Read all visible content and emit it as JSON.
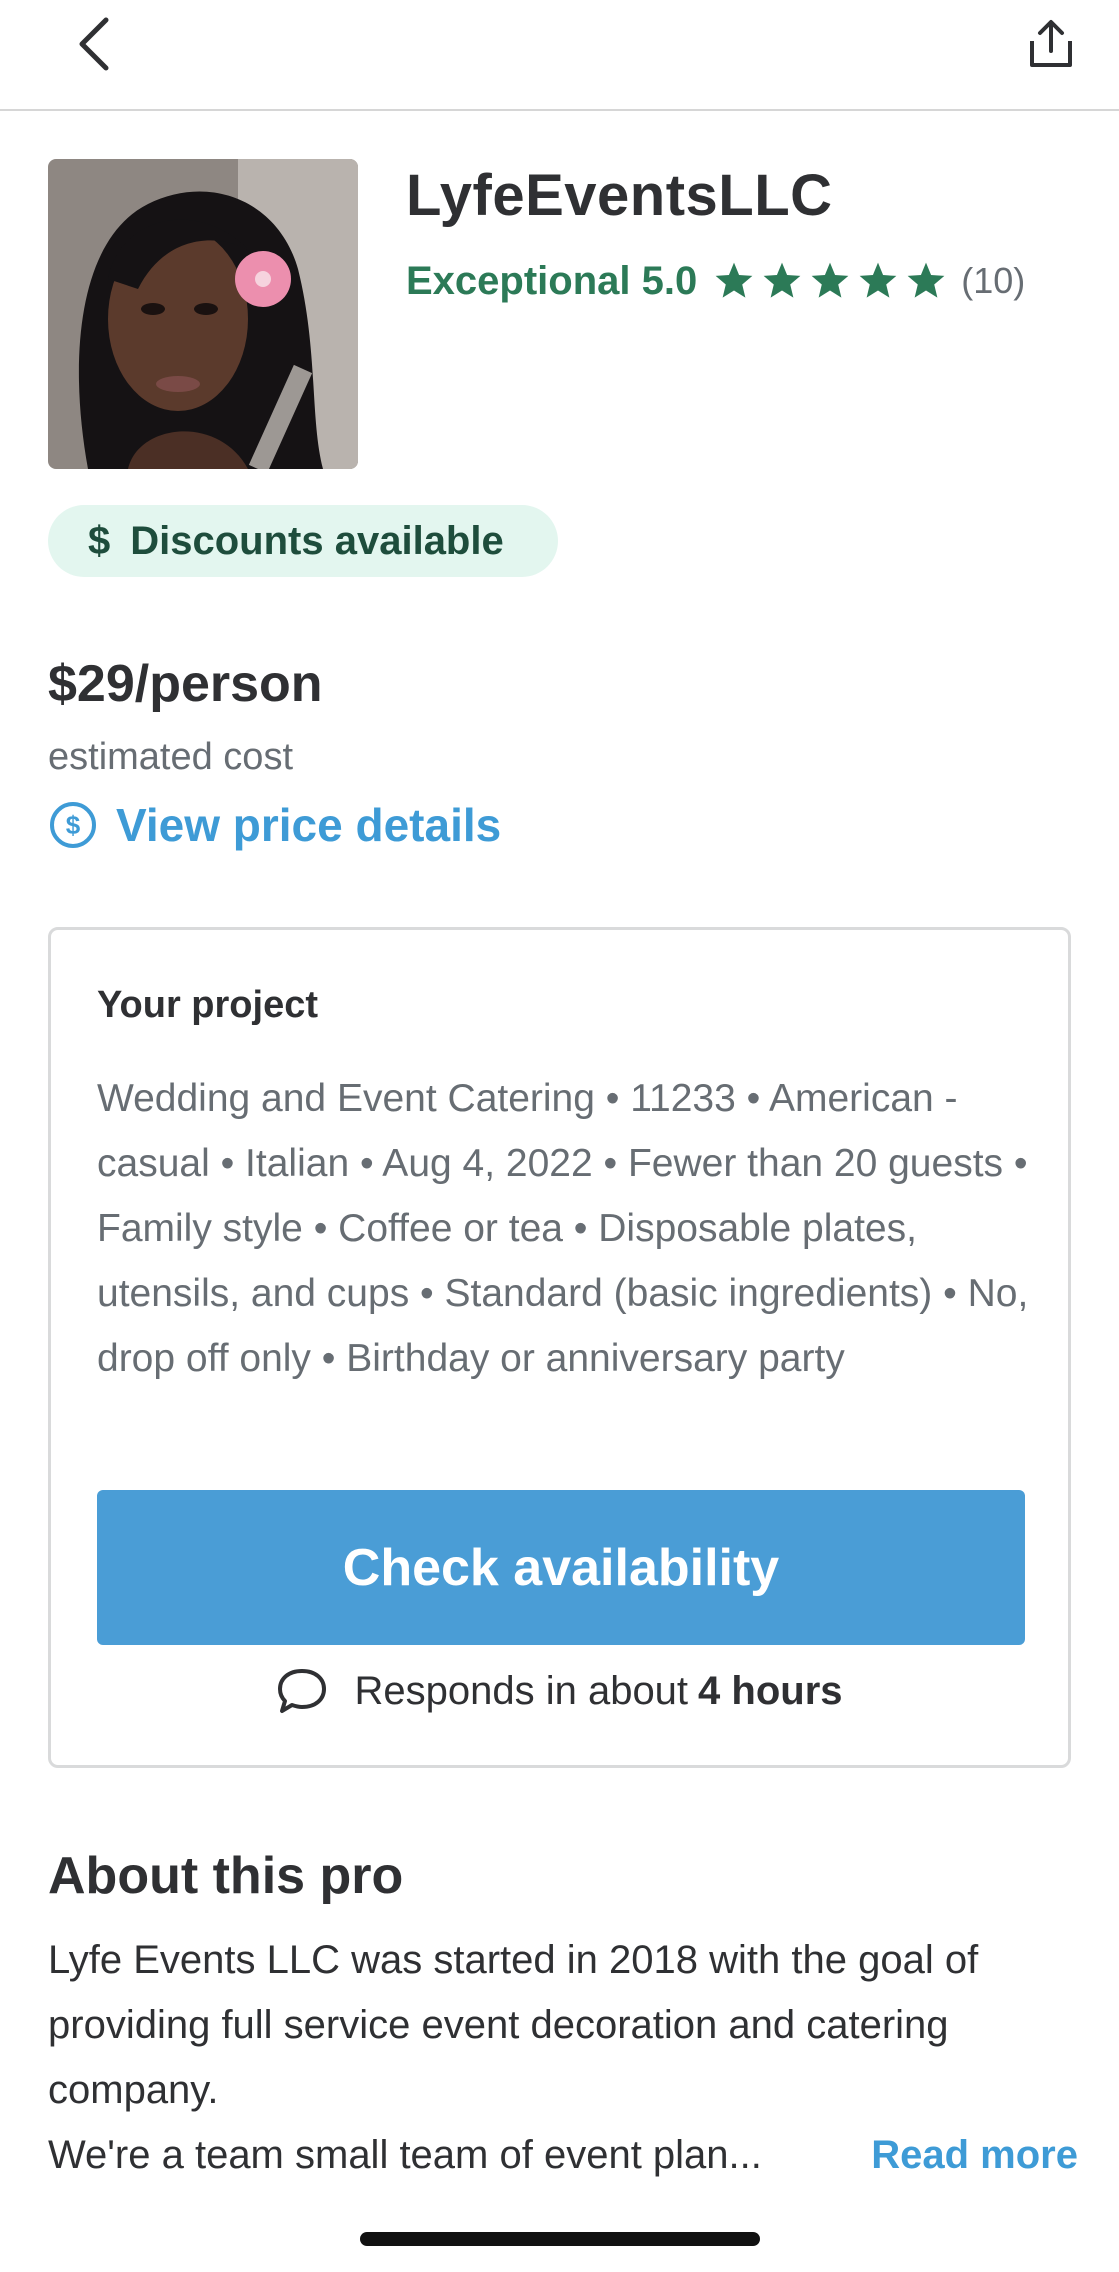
{
  "header": {
    "back_icon": "chevron-left-icon",
    "share_icon": "share-icon"
  },
  "pro": {
    "name": "LyfeEventsLLC",
    "rating_label": "Exceptional 5.0",
    "stars": 5,
    "review_count": "(10)",
    "avatar_description": "profile photo"
  },
  "discount": {
    "icon": "$",
    "label": "Discounts available"
  },
  "pricing": {
    "price": "$29/person",
    "subtitle": "estimated cost",
    "link_label": "View price details"
  },
  "project": {
    "title": "Your project",
    "description": "Wedding and Event Catering • 11233 • American - casual • Italian • Aug 4, 2022 • Fewer than 20 guests • Family style • Coffee or tea • Disposable plates, utensils, and cups • Standard (basic ingredients) • No, drop off only • Birthday or anniversary party",
    "cta_label": "Check availability",
    "responds_prefix": "Responds in about",
    "responds_time": "4 hours"
  },
  "about": {
    "title": "About this pro",
    "text": "Lyfe Events LLC was started in 2018 with the goal of providing full service event decoration and catering company.",
    "last_line": "We're a team small team of event plan...",
    "read_more": "Read more"
  },
  "colors": {
    "accent_blue": "#4a9dd6",
    "link_blue": "#3e9bd6",
    "rating_green": "#2c7a57",
    "discount_bg": "#e3f6ef"
  }
}
